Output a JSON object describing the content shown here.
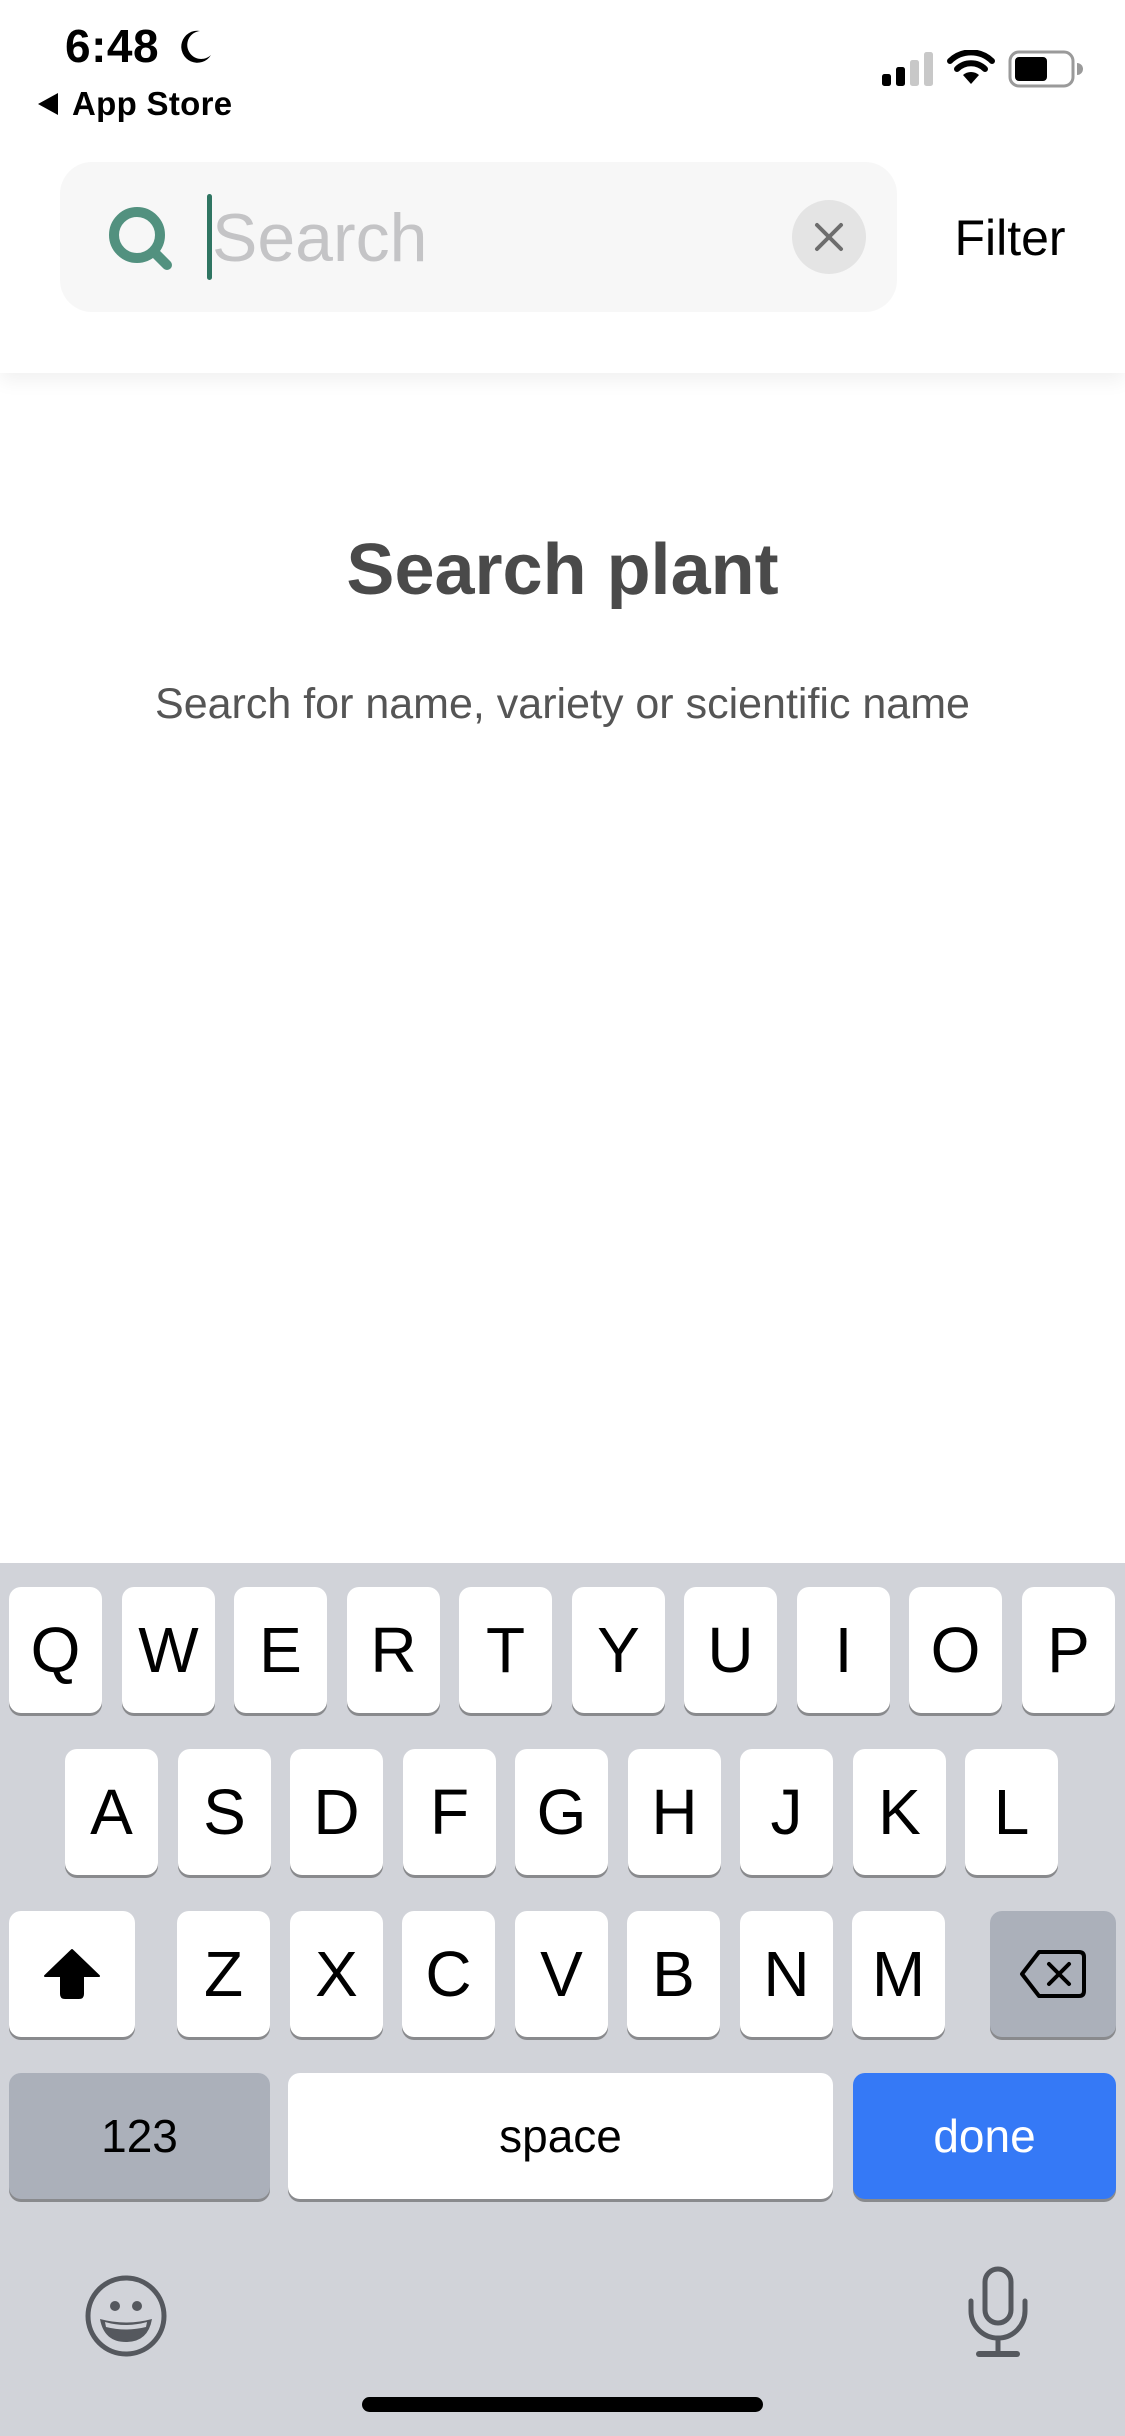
{
  "status_bar": {
    "time": "6:48",
    "focus_mode_icon": "moon-icon",
    "back_app_label": "App Store",
    "signal_bars_active": 2,
    "signal_bars_total": 4,
    "wifi_icon": "wifi-icon",
    "battery_level_fraction": 0.6
  },
  "header": {
    "search": {
      "value": "",
      "placeholder": "Search",
      "icon": "search-icon",
      "clear_icon": "close-icon"
    },
    "filter_label": "Filter"
  },
  "empty_state": {
    "title": "Search plant",
    "subtitle": "Search for name, variety or scientific name"
  },
  "keyboard": {
    "row1": [
      "Q",
      "W",
      "E",
      "R",
      "T",
      "Y",
      "U",
      "I",
      "O",
      "P"
    ],
    "row2": [
      "A",
      "S",
      "D",
      "F",
      "G",
      "H",
      "J",
      "K",
      "L"
    ],
    "row3": [
      "Z",
      "X",
      "C",
      "V",
      "B",
      "N",
      "M"
    ],
    "numbers_label": "123",
    "space_label": "space",
    "return_label": "done",
    "shift_icon": "shift-icon",
    "delete_icon": "delete-icon",
    "emoji_icon": "emoji-icon",
    "dictation_icon": "microphone-icon"
  },
  "colors": {
    "accent_green": "#52917f",
    "caret_green": "#2f7562",
    "placeholder_gray": "#c4c4c6",
    "done_blue": "#3579f6",
    "keyboard_bg": "#d1d3d9",
    "dark_key": "#abb0ba",
    "title_gray": "#4a4a4a"
  }
}
